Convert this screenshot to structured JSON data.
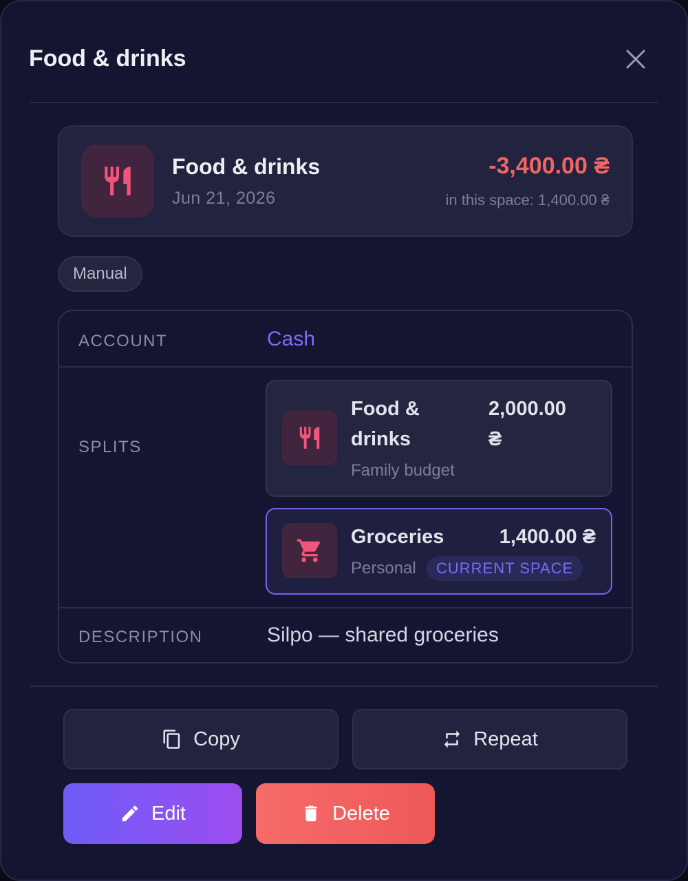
{
  "dialog": {
    "title": "Food & drinks"
  },
  "summary": {
    "icon": "cutlery-icon",
    "name": "Food & drinks",
    "date": "Jun 21, 2026",
    "amount": "-3,400.00 ₴",
    "space_amount": "in this space: 1,400.00 ₴"
  },
  "badge": "Manual",
  "details": {
    "account_label": "ACCOUNT",
    "account_value": "Cash",
    "splits_label": "SPLITS",
    "splits": [
      {
        "icon": "cutlery-icon",
        "name_line1": "Food &",
        "name_line2": "drinks",
        "space": "Family budget",
        "amount_line1": "2,000.00",
        "amount_line2": "₴"
      },
      {
        "icon": "cart-icon",
        "name": "Groceries",
        "space": "Personal",
        "amount": "1,400.00 ₴",
        "tag": "CURRENT SPACE"
      }
    ],
    "description_label": "DESCRIPTION",
    "description_value": "Silpo — shared groceries"
  },
  "actions": {
    "copy": "Copy",
    "repeat": "Repeat",
    "edit": "Edit",
    "delete": "Delete"
  },
  "colors": {
    "accent": "#7a6cf6",
    "negative": "#f26565",
    "icon_pink": "#f2557b"
  }
}
